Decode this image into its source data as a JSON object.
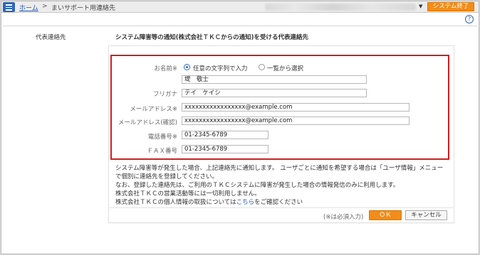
{
  "header": {
    "breadcrumb_home": "ホーム",
    "breadcrumb_separator": ">",
    "breadcrumb_current": "まいサポート用連絡先",
    "user_caret": "▼",
    "exit_label": "システム終了",
    "help_symbol": "?"
  },
  "section": {
    "label": "代表連絡先",
    "description": "システム障害等の通知(株式会社ＴＫＣからの通知)を受ける代表連絡先"
  },
  "form": {
    "name_label": "お名前※",
    "radio_free_text": "任意の文字列で入力",
    "radio_from_list": "一覧から選択",
    "name_value": "堤　敬士",
    "kana_label": "フリガナ",
    "kana_value": "テイ　ケイシ",
    "email_label": "メールアドレス※",
    "email_value": "xxxxxxxxxxxxxxxxx@example.com",
    "email_confirm_label": "メールアドレス(確認)",
    "email_confirm_value": "xxxxxxxxxxxxxxxxx@example.com",
    "phone_label": "電話番号※",
    "phone_value": "01-2345-6789",
    "fax_label": "ＦＡＸ番号",
    "fax_value": "01-2345-6789"
  },
  "notes": {
    "line1": "システム障害等が発生した場合、上記連絡先に通知します。 ユーザごとに通知を希望する場合は「ユーザ情報」メニュー",
    "line2": "で個別に連絡先を登録してください。",
    "line3": "なお、登録した連絡先は、ご利用のＴＫＣシステムに障害が発生した場合の情報発信のみに利用します。",
    "line4": "株式会社ＴＫＣの営業活動等には一切利用しません。",
    "line5_prefix": "株式会社ＴＫＣの個人情報の取扱については",
    "line5_link": "こちら",
    "line5_suffix": "をご確認ください"
  },
  "footer": {
    "required_note": "(※は必須入力)",
    "ok_label": "ＯＫ",
    "cancel_label": "キャンセル"
  },
  "colors": {
    "accent_orange": "#f28c1a",
    "link_blue": "#1a55c0",
    "highlight_red": "#d41d1d",
    "menu_blue": "#2e68b8"
  }
}
